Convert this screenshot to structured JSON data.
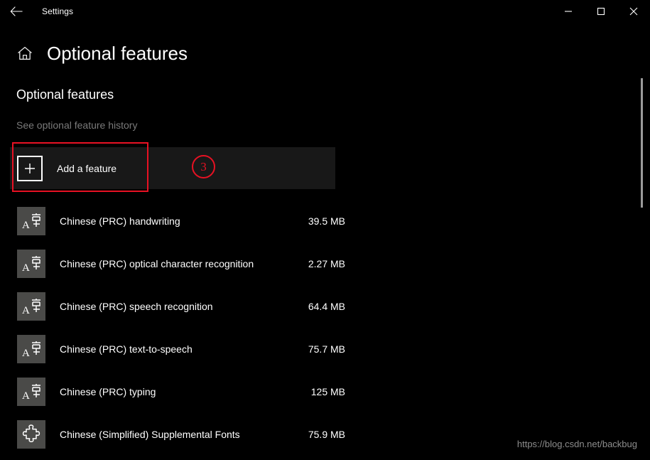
{
  "window": {
    "app_title": "Settings",
    "back_icon": "back-arrow-icon",
    "minimize_label": "—",
    "maximize_label": "□",
    "close_label": "✕"
  },
  "header": {
    "home_icon": "home-icon",
    "title": "Optional features"
  },
  "section": {
    "title": "Optional features",
    "history_link": "See optional feature history"
  },
  "add_feature": {
    "label": "Add a feature",
    "icon": "plus-icon"
  },
  "annotation": {
    "number": "3",
    "color": "#e81123"
  },
  "features": [
    {
      "name": "Chinese (PRC) handwriting",
      "size": "39.5 MB",
      "icon": "language-pack-icon"
    },
    {
      "name": "Chinese (PRC) optical character recognition",
      "size": "2.27 MB",
      "icon": "language-pack-icon"
    },
    {
      "name": "Chinese (PRC) speech recognition",
      "size": "64.4 MB",
      "icon": "language-pack-icon"
    },
    {
      "name": "Chinese (PRC) text-to-speech",
      "size": "75.7 MB",
      "icon": "language-pack-icon"
    },
    {
      "name": "Chinese (PRC) typing",
      "size": "125 MB",
      "icon": "language-pack-icon"
    },
    {
      "name": "Chinese (Simplified) Supplemental Fonts",
      "size": "75.9 MB",
      "icon": "puzzle-piece-icon"
    }
  ],
  "watermark": "https://blog.csdn.net/backbug",
  "colors": {
    "background": "#000000",
    "row_highlight": "#181818",
    "icon_tile": "#4a4a48",
    "muted_text": "#7a7a7a",
    "accent_red": "#e81123"
  }
}
